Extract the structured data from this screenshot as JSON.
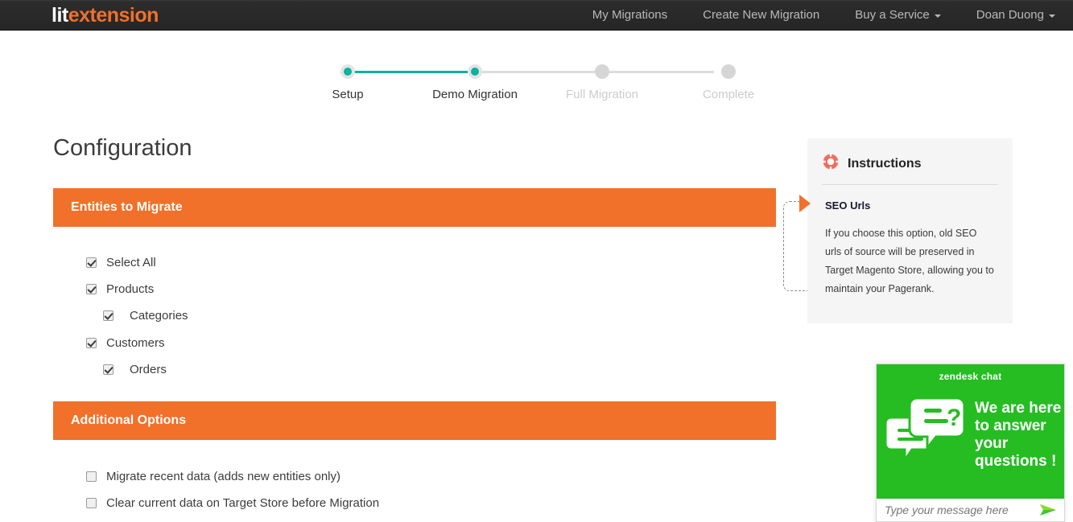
{
  "header": {
    "logo_primary": "lit",
    "logo_secondary": "extension",
    "nav": [
      {
        "label": "My Migrations",
        "has_caret": false
      },
      {
        "label": "Create New Migration",
        "has_caret": false
      },
      {
        "label": "Buy a Service",
        "has_caret": true
      },
      {
        "label": "Doan Duong",
        "has_caret": true
      }
    ]
  },
  "stepper": {
    "active_color": "#0ab39c",
    "inactive_color": "#d6d6d6",
    "steps": [
      {
        "label": "Setup",
        "state": "done"
      },
      {
        "label": "Demo Migration",
        "state": "done"
      },
      {
        "label": "Full Migration",
        "state": "pending"
      },
      {
        "label": "Complete",
        "state": "pending"
      }
    ]
  },
  "main": {
    "page_title": "Configuration",
    "accent_color": "#f1702a",
    "entities": {
      "header": "Entities to Migrate",
      "items": [
        {
          "label": "Select All",
          "checked": true,
          "indent": 0
        },
        {
          "label": "Products",
          "checked": true,
          "indent": 0
        },
        {
          "label": "Categories",
          "checked": true,
          "indent": 1
        },
        {
          "label": "Customers",
          "checked": true,
          "indent": 0
        },
        {
          "label": "Orders",
          "checked": true,
          "indent": 1
        }
      ]
    },
    "additional": {
      "header": "Additional Options",
      "items": [
        {
          "label": "Migrate recent data (adds new entities only)",
          "checked": false
        },
        {
          "label": "Clear current data on Target Store before Migration",
          "checked": false
        }
      ]
    }
  },
  "instructions": {
    "title": "Instructions",
    "icon": "lifebuoy-icon",
    "subtitle": "SEO Urls",
    "body": "If you choose this option, old SEO urls of source will be preserved in Target Magento Store, allowing you to maintain your Pagerank."
  },
  "chat": {
    "brand": "zendesk chat",
    "message": "We are here\nto answer\nyour\nquestions !",
    "message_lines": [
      "We are here",
      "to answer",
      "your",
      "questions !"
    ],
    "input_placeholder": "Type your message here",
    "background_color": "#25bd22",
    "send_icon": "send-arrow-icon"
  }
}
